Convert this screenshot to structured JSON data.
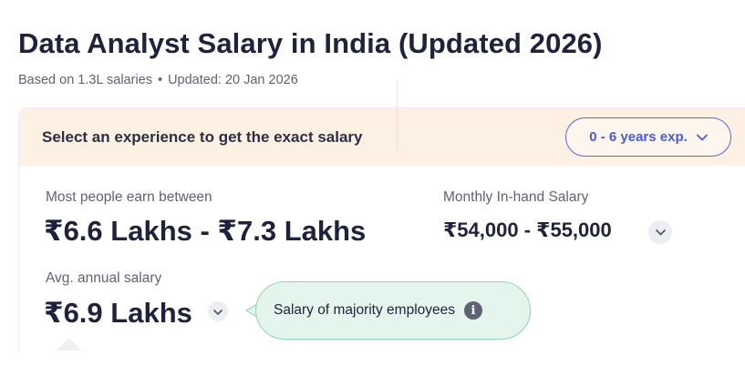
{
  "page": {
    "title": "Data Analyst Salary in India (Updated 2026)",
    "subtitle_salaries": "Based on 1.3L salaries",
    "subtitle_sep": "•",
    "subtitle_updated": "Updated: 20 Jan 2026"
  },
  "experience_bar": {
    "prompt": "Select an experience to get the exact salary",
    "selected_value": "0 - 6 years exp.",
    "icon": "chevron-down-icon"
  },
  "stats": {
    "range_label": "Most people earn between",
    "range_value": "₹6.6 Lakhs - ₹7.3 Lakhs",
    "monthly_label": "Monthly In-hand Salary",
    "monthly_value": "₹54,000 - ₹55,000",
    "avg_label": "Avg. annual salary",
    "avg_value": "₹6.9 Lakhs"
  },
  "tooltip": {
    "text": "Salary of majority employees",
    "icon": "info-icon",
    "icon_glyph": "i"
  },
  "colors": {
    "accent": "#4b5bd8",
    "header_bg": "#fdf1e3",
    "tooltip_bg": "#e3f5ec",
    "tooltip_border": "#8fd4b0",
    "text_primary": "#1e223c",
    "text_secondary": "#5e6274"
  }
}
